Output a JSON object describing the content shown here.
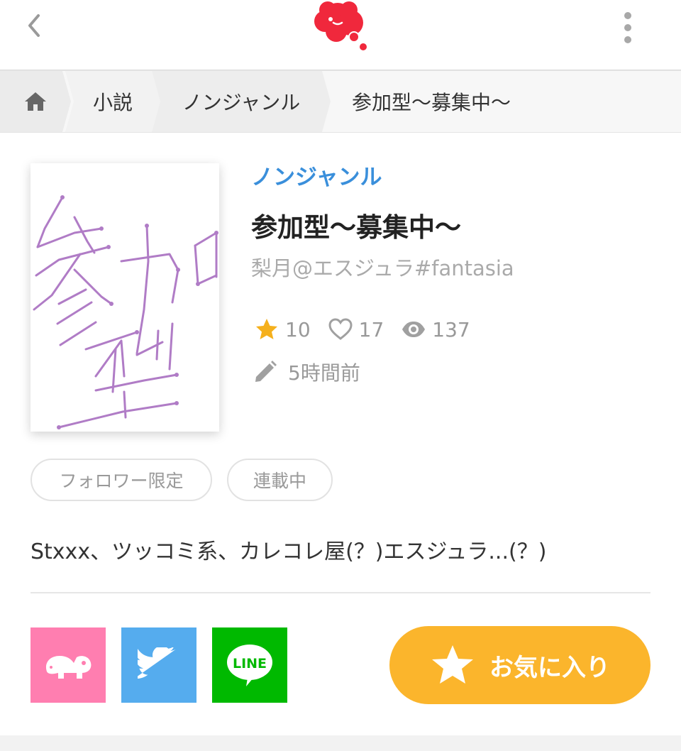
{
  "breadcrumb": {
    "items": [
      {
        "label": "小説"
      },
      {
        "label": "ノンジャンル"
      },
      {
        "label": "参加型〜募集中〜"
      }
    ]
  },
  "cover": {
    "handwritten_text": "参加型",
    "stroke_color": "#b07cc6"
  },
  "work": {
    "genre": "ノンジャンル",
    "title": "参加型〜募集中〜",
    "author": "梨月@エスジュラ#fantasia",
    "stats": {
      "stars": "10",
      "likes": "17",
      "views": "137"
    },
    "updated": "5時間前",
    "tags": [
      "フォロワー限定",
      "連載中"
    ],
    "description": "Stxxx、ツッコミ系、カレコレ屋(？)エスジュラ...(？)"
  },
  "share": {
    "line_label": "LINE"
  },
  "favorite": {
    "label": "お気に入り"
  },
  "colors": {
    "accent_genre": "#3a8fdb",
    "favorite_button": "#fbb52c",
    "brand_logo": "#f0283c",
    "share_pink": "#ff7eb0",
    "share_twitter": "#55acee",
    "share_line": "#00b900",
    "star": "#f5b01c"
  },
  "icons": [
    "back-arrow-icon",
    "logo-icon",
    "more-vert-icon",
    "home-icon",
    "star-icon",
    "heart-icon",
    "eye-icon",
    "pencil-icon",
    "elephant-icon",
    "twitter-bird-icon",
    "line-icon"
  ]
}
